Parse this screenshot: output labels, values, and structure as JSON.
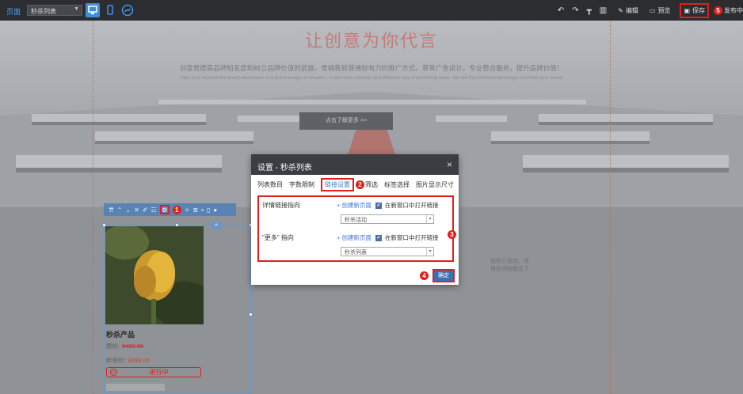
{
  "topbar": {
    "page_label": "页面",
    "page_select": "秒杀列表",
    "edit": "编辑",
    "preview": "预览",
    "save": "保存",
    "save_badge": "5",
    "publish": "发布中"
  },
  "hero": {
    "title": "让创意为你代言",
    "subtitle": "创意是提高品牌知名度和树立品牌价值的武器，是销售较普通较有力的推广方式。草草广告设计，专业整合服务，提升品牌价值！",
    "subtitle_en": "Idea is to improve the brand awareness and brand image of weapons, is the most common and effective way of promoting sales. We are the professional design, promote your brand",
    "button": "点击了解更多 >>"
  },
  "controls": {
    "badge": "1"
  },
  "product": {
    "name": "秒杀产品",
    "orig_label": "原价:",
    "orig_value": "¥499.00",
    "sale_label": "秒杀价:",
    "sale_value": "¥399.00",
    "status": "进行中"
  },
  "side_text": {
    "line1": "组件已添加，很",
    "line2": "将在浏览模式下"
  },
  "dialog": {
    "title": "设置 - 秒杀列表",
    "close": "×",
    "tabs": [
      "列表数目",
      "字数限制",
      "链接设置",
      "筛选",
      "标签选择",
      "图片显示尺寸"
    ],
    "tab_badge": "2",
    "rows": [
      {
        "label": "详情链接指向",
        "create": "+ 创建新页面",
        "open": "在新窗口中打开链接",
        "select": "秒杀活动"
      },
      {
        "label": "\"更多\" 指向",
        "create": "+ 创建新页面",
        "open": "在新窗口中打开链接",
        "select": "秒杀列表"
      }
    ],
    "panel_badge": "3",
    "ok": "确定",
    "ok_badge": "4"
  }
}
